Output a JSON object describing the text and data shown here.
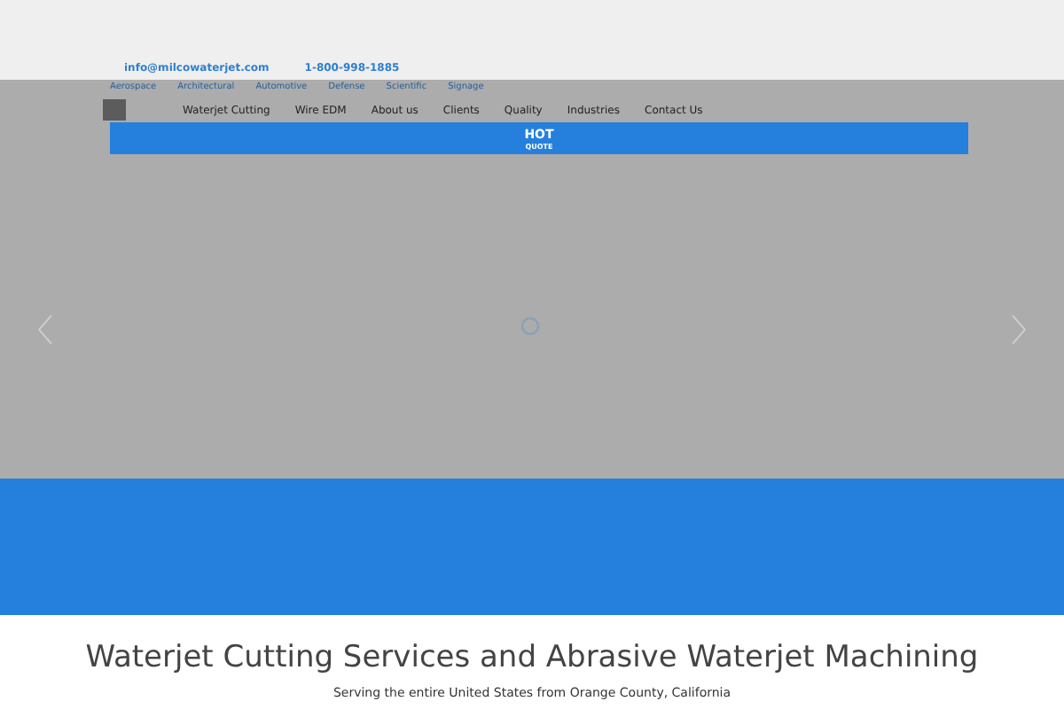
{
  "topbar": {
    "email": "info@milcowaterjet.com",
    "phone": "1-800-998-1885"
  },
  "subnav": [
    "Aerospace",
    "Architectural",
    "Automotive",
    "Defense",
    "Scientific",
    "Signage"
  ],
  "nav": [
    {
      "label": "Waterjet Cutting",
      "selected": false
    },
    {
      "label": "Wire EDM",
      "selected": false
    },
    {
      "label": "About us",
      "selected": false
    },
    {
      "label": "Clients",
      "selected": false
    },
    {
      "label": "Quality",
      "selected": false
    },
    {
      "label": "Industries",
      "selected": false
    },
    {
      "label": "Contact Us",
      "selected": false
    }
  ],
  "quote_bar": {
    "title": "HOT",
    "subtitle": "QUOTE"
  },
  "heading": "Waterjet Cutting Services and Abrasive Waterjet Machining",
  "subheading": "Serving the entire United States from Orange County, California"
}
